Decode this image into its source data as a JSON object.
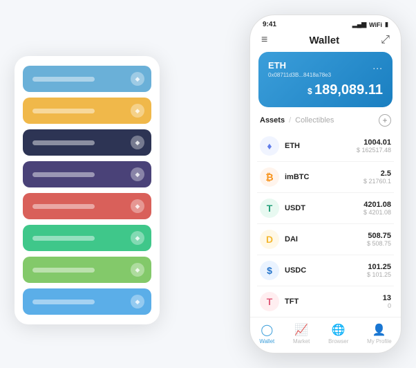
{
  "scene": {
    "cardStack": {
      "cards": [
        {
          "color": "#6ab0d8",
          "iconChar": "◆"
        },
        {
          "color": "#f0b84a",
          "iconChar": "◆"
        },
        {
          "color": "#2d3454",
          "iconChar": "◆"
        },
        {
          "color": "#4a4278",
          "iconChar": "◆"
        },
        {
          "color": "#d9605a",
          "iconChar": "◆"
        },
        {
          "color": "#3fc78a",
          "iconChar": "◆"
        },
        {
          "color": "#83c96a",
          "iconChar": "◆"
        },
        {
          "color": "#5baee8",
          "iconChar": "◆"
        }
      ]
    }
  },
  "phone": {
    "statusBar": {
      "time": "9:41",
      "signal": "▂▄▆",
      "wifi": "▾",
      "battery": "▮"
    },
    "header": {
      "menuIcon": "≡",
      "title": "Wallet",
      "expandIcon": "⤢"
    },
    "walletCard": {
      "label": "ETH",
      "address": "0x08711d3B...8418a78e3",
      "addressSuffix": "⚙",
      "dots": "...",
      "balanceDollar": "$",
      "balance": "189,089.11"
    },
    "tabs": {
      "active": "Assets",
      "divider": "/",
      "inactive": "Collectibles",
      "addIcon": "+"
    },
    "assets": [
      {
        "symbol": "ETH",
        "iconBg": "#f0f4ff",
        "iconColor": "#627eea",
        "iconChar": "♦",
        "amount": "1004.01",
        "usd": "$ 162517.48"
      },
      {
        "symbol": "imBTC",
        "iconBg": "#fff4ec",
        "iconColor": "#f7931a",
        "iconChar": "₿",
        "amount": "2.5",
        "usd": "$ 21760.1"
      },
      {
        "symbol": "USDT",
        "iconBg": "#e8f9f1",
        "iconColor": "#26a17b",
        "iconChar": "T",
        "amount": "4201.08",
        "usd": "$ 4201.08"
      },
      {
        "symbol": "DAI",
        "iconBg": "#fff8e6",
        "iconColor": "#f4b731",
        "iconChar": "D",
        "amount": "508.75",
        "usd": "$ 508.75"
      },
      {
        "symbol": "USDC",
        "iconBg": "#eaf3ff",
        "iconColor": "#2775ca",
        "iconChar": "$",
        "amount": "101.25",
        "usd": "$ 101.25"
      },
      {
        "symbol": "TFT",
        "iconBg": "#ffeef0",
        "iconColor": "#e05c7a",
        "iconChar": "T",
        "amount": "13",
        "usd": "0"
      }
    ],
    "bottomNav": [
      {
        "label": "Wallet",
        "icon": "◎",
        "active": true
      },
      {
        "label": "Market",
        "icon": "📈",
        "active": false
      },
      {
        "label": "Browser",
        "icon": "🌐",
        "active": false
      },
      {
        "label": "My Profile",
        "icon": "👤",
        "active": false
      }
    ]
  }
}
